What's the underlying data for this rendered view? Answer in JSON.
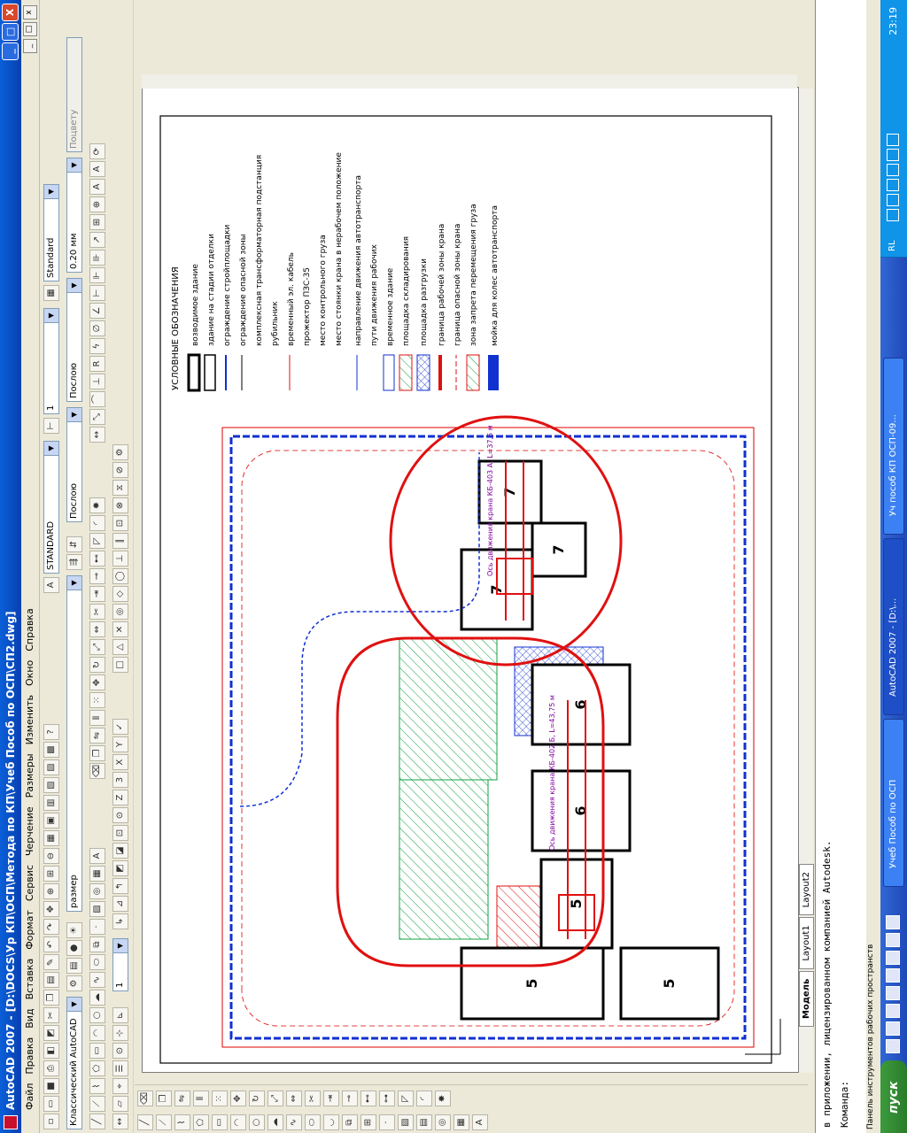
{
  "window": {
    "title": "AutoCAD 2007 - [D:\\DOCS\\Ур КП\\ОСП\\Метода по КП\\Учеб Пособ по ОСП\\СП2.dwg]",
    "buttons": [
      "_",
      "□",
      "X"
    ]
  },
  "menu": [
    "Файл",
    "Правка",
    "Вид",
    "Вставка",
    "Формат",
    "Сервис",
    "Черчение",
    "Размеры",
    "Изменить",
    "Окно",
    "Справка"
  ],
  "toolbar": {
    "workspace": "Классический AutoCAD",
    "text_style": "STANDARD",
    "dim_style": "Standard",
    "layer": "размер",
    "scale": "1",
    "color": "Послою",
    "linetype": "Послою",
    "lineweight": "0.20 мм",
    "plotstyle": "Поцвету",
    "scale2": "1"
  },
  "legend": {
    "title": "УСЛОВНЫЕ ОБОЗНАЧЕНИЯ",
    "items": [
      "возводимое здание",
      "здание на стадии отделки",
      "ограждение стройплощадки",
      "ограждение опасной зоны",
      "комплексная трансформаторная подстанция",
      "рубильник",
      "временный эл. кабель",
      "прожектор ПЗС-35",
      "место контрольного груза",
      "место стоянки крана в нерабочем положение",
      "направление движения автотранспорта",
      "пути движения рабочих",
      "временное здание",
      "площадка складирования",
      "площадка разгрузки",
      "граница рабочей зоны крана",
      "граница опасной зоны крана",
      "зона запрета перемещения груза",
      "мойка для колес автотранспорта"
    ]
  },
  "plan_labels": {
    "buildings": [
      "5",
      "5",
      "5",
      "6",
      "6",
      "7",
      "7",
      "7"
    ],
    "crane1": "Ось движения крана КБ-402 Б, L=43,75 м",
    "crane2": "Ось движения крана КБ-403 А, L=37,5 м"
  },
  "tabs": [
    "Модель",
    "Layout1",
    "Layout2"
  ],
  "command": {
    "line1": "в приложении, лицензированном компанией Autodesk.",
    "line2": "Команда:"
  },
  "panel_label": "Панель инструментов рабочих пространств",
  "taskbar": {
    "start": "пуск",
    "buttons": [
      "Учеб Пособ по ОСП",
      "AutoCAD 2007 - [D:\\...",
      "Уч пособ КП ОСП-09..."
    ],
    "lang": "RL",
    "clock": "23:19"
  },
  "colors": {
    "fence": "#1030d0",
    "crane_zone": "#e01010",
    "dim": "#8000a0",
    "hatch": "#10a040"
  }
}
